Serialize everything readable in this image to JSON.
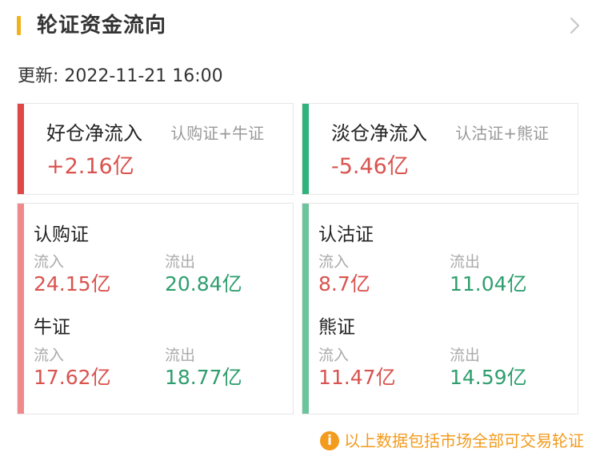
{
  "header": {
    "title": "轮证资金流向",
    "chevron_icon": "chevron-right-icon"
  },
  "updated": "更新: 2022-11-21 16:00",
  "net": [
    {
      "name": "好仓净流入",
      "sub": "认购证+牛证",
      "value": "+2.16亿",
      "accent": "#e04848"
    },
    {
      "name": "淡仓净流入",
      "sub": "认沽证+熊证",
      "value": "-5.46亿",
      "accent": "#2fb37a"
    }
  ],
  "details": [
    {
      "accent": "#f08a8a",
      "groups": [
        {
          "title": "认购证",
          "in_label": "流入",
          "in_value": "24.15亿",
          "out_label": "流出",
          "out_value": "20.84亿"
        },
        {
          "title": "牛证",
          "in_label": "流入",
          "in_value": "17.62亿",
          "out_label": "流出",
          "out_value": "18.77亿"
        }
      ]
    },
    {
      "accent": "#6cc49c",
      "groups": [
        {
          "title": "认沽证",
          "in_label": "流入",
          "in_value": "8.7亿",
          "out_label": "流出",
          "out_value": "11.04亿"
        },
        {
          "title": "熊证",
          "in_label": "流入",
          "in_value": "11.47亿",
          "out_label": "流出",
          "out_value": "14.59亿"
        }
      ]
    }
  ],
  "footnote": {
    "icon": "info-icon",
    "text": "以上数据包括市场全部可交易轮证"
  }
}
